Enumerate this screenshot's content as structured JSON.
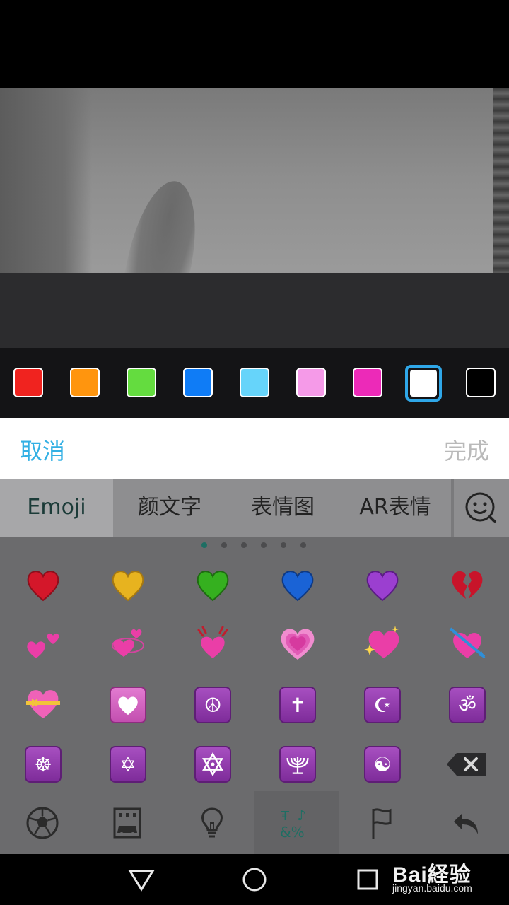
{
  "palette": {
    "colors": [
      {
        "name": "red",
        "hex": "#f0231f"
      },
      {
        "name": "orange",
        "hex": "#ff950e"
      },
      {
        "name": "green",
        "hex": "#64dc3f"
      },
      {
        "name": "blue",
        "hex": "#0f7cf6"
      },
      {
        "name": "light-blue",
        "hex": "#66d4fa"
      },
      {
        "name": "pink",
        "hex": "#f59ae8"
      },
      {
        "name": "magenta",
        "hex": "#ec2ab8"
      },
      {
        "name": "white",
        "hex": "#ffffff",
        "selected": true
      },
      {
        "name": "black",
        "hex": "#000000"
      }
    ],
    "selection_color": "#2fa7e8"
  },
  "actionbar": {
    "cancel_label": "取消",
    "done_label": "完成",
    "cancel_color": "#33b0e4"
  },
  "keyboard": {
    "tabs": [
      {
        "label": "Emoji",
        "active": true
      },
      {
        "label": "颜文字"
      },
      {
        "label": "表情图"
      },
      {
        "label": "AR表情"
      }
    ],
    "face_icon": "smiley-search-icon",
    "page_dots": {
      "count": 6,
      "active": 0
    },
    "emoji_rows": [
      [
        "red-heart",
        "yellow-heart",
        "green-heart",
        "blue-heart",
        "purple-heart",
        "broken-heart"
      ],
      [
        "two-hearts",
        "revolving-hearts",
        "heart-exclamation",
        "growing-heart",
        "sparkling-heart",
        "heart-with-arrow"
      ],
      [
        "heart-with-ribbon",
        "heart-decoration",
        "peace-symbol",
        "latin-cross",
        "star-and-crescent",
        "om-symbol"
      ],
      [
        "wheel-of-dharma",
        "star-of-david",
        "six-pointed-star",
        "menorah",
        "yin-yang",
        "backspace"
      ]
    ],
    "symbols": {
      "peace": "☮",
      "cross": "✝",
      "crescent": "☪",
      "om": "ॐ",
      "dharma": "☸",
      "david": "✡",
      "star6": "🔯",
      "menorah": "🕎",
      "yinyang": "☯"
    },
    "categories": [
      {
        "icon": "soccer-ball-icon"
      },
      {
        "icon": "building-car-icon"
      },
      {
        "icon": "lightbulb-icon"
      },
      {
        "icon": "symbols-icon",
        "active": true
      },
      {
        "icon": "flag-icon"
      },
      {
        "icon": "return-icon"
      }
    ]
  },
  "navbar": {
    "buttons": [
      "back-icon",
      "home-icon",
      "recents-icon"
    ]
  },
  "watermark": {
    "brand": "Bai経验",
    "url": "jingyan.baidu.com"
  }
}
